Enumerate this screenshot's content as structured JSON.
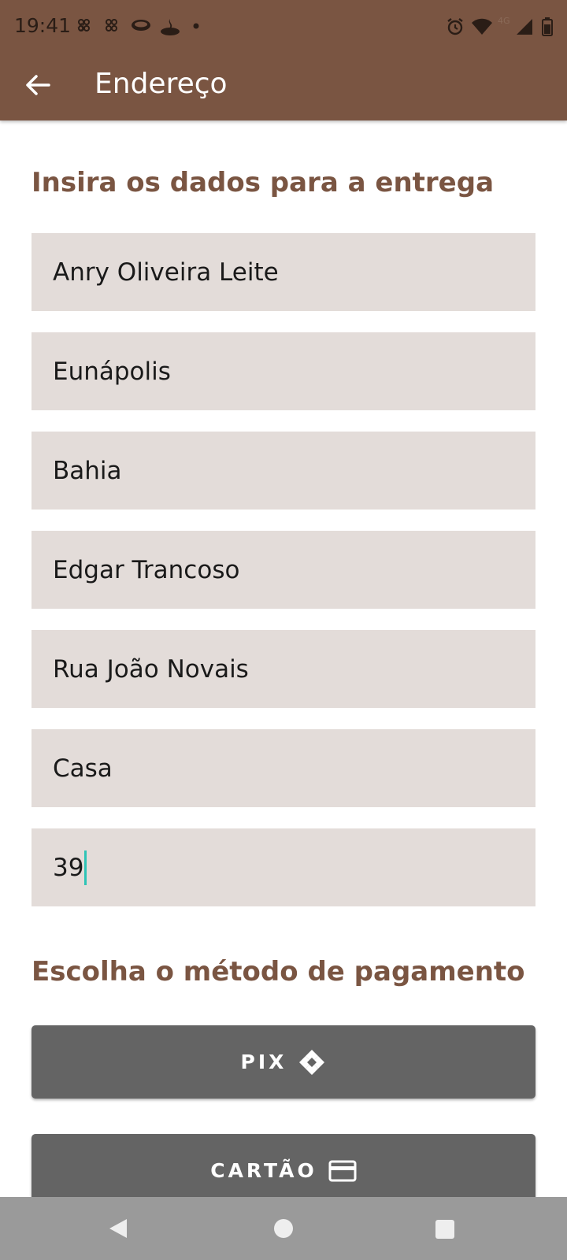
{
  "status_bar": {
    "time": "19:41",
    "network": "4G",
    "icons": [
      "app-notification-icon",
      "app-notification-icon",
      "coffee-icon",
      "santander-icon",
      "dot-icon",
      "alarm-icon",
      "wifi-icon",
      "signal-icon",
      "battery-icon"
    ]
  },
  "app_bar": {
    "title": "Endereço",
    "back_icon": "arrow-left-icon"
  },
  "delivery": {
    "heading": "Insira os dados para a entrega",
    "fields": [
      {
        "value": "Anry Oliveira Leite"
      },
      {
        "value": "Eunápolis"
      },
      {
        "value": "Bahia"
      },
      {
        "value": "Edgar Trancoso"
      },
      {
        "value": "Rua João Novais"
      },
      {
        "value": "Casa"
      },
      {
        "value": "39",
        "focused": true
      }
    ]
  },
  "payment": {
    "heading": "Escolha o método de pagamento",
    "pix_label": "PIX",
    "pix_icon": "pix-icon",
    "card_label": "CARTÃO",
    "card_icon": "credit-card-icon"
  },
  "nav_bar": {
    "icons": [
      "back-triangle-icon",
      "home-circle-icon",
      "recents-square-icon"
    ]
  },
  "colors": {
    "brand": "#7a5542",
    "field_bg": "#e3dcd9",
    "button_bg": "#646464",
    "cursor": "#2ec4b6"
  }
}
